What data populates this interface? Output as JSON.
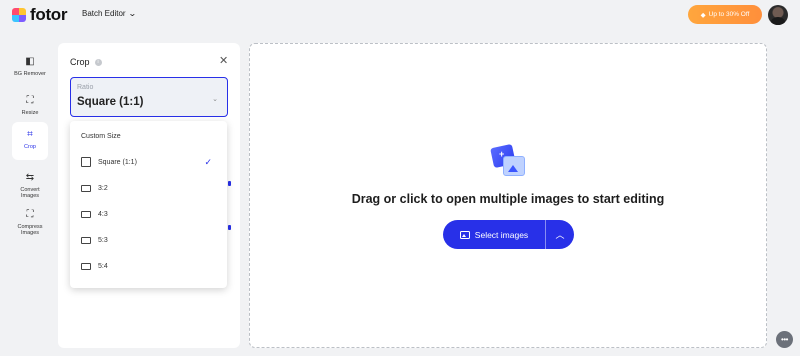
{
  "brand": {
    "name": "fotor"
  },
  "topbar": {
    "menu_label": "Batch Editor",
    "promo_label": "Up to 30% Off"
  },
  "tools": [
    {
      "label": "BG Remover",
      "icon": "bg-remover-icon"
    },
    {
      "label": "Resize",
      "icon": "resize-icon"
    },
    {
      "label": "Crop",
      "icon": "crop-icon",
      "active": true
    },
    {
      "label": "Convert Images",
      "icon": "convert-icon"
    },
    {
      "label": "Compress Images",
      "icon": "compress-icon"
    }
  ],
  "panel": {
    "title": "Crop",
    "ratio_caption": "Ratio",
    "ratio_value": "Square (1:1)",
    "options": [
      "Custom Size",
      "Square (1:1)",
      "3:2",
      "4:3",
      "5:3",
      "5:4"
    ],
    "selected_option": "Square (1:1)"
  },
  "dropzone": {
    "message": "Drag or click to open multiple images to start editing",
    "button_label": "Select images"
  },
  "colors": {
    "accent": "#2830e8",
    "promo": "#ff9a3c"
  }
}
